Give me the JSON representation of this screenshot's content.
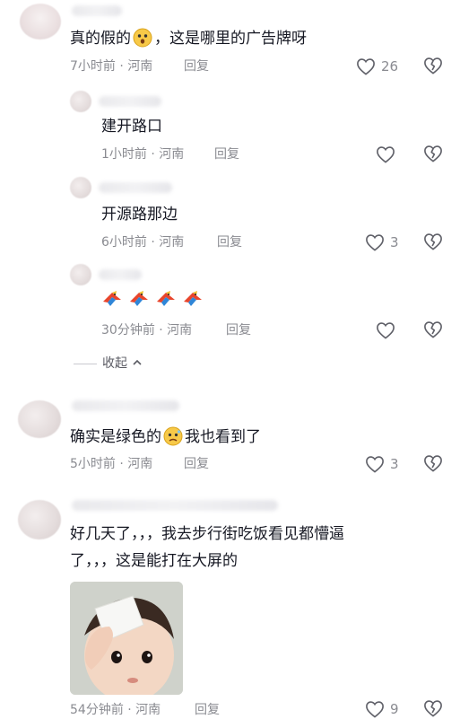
{
  "comments": [
    {
      "text": "真的假的",
      "text_after_emoji": "，这是哪里的广告牌呀",
      "meta": "7小时前 · 河南",
      "reply_label": "回复",
      "likes": "26",
      "replies": [
        {
          "text": "建开路口",
          "meta": "1小时前 · 河南",
          "reply_label": "回复",
          "likes": ""
        },
        {
          "text": "开源路那边",
          "meta": "6小时前 · 河南",
          "reply_label": "回复",
          "likes": "3"
        },
        {
          "text": "",
          "meta": "30分钟前 · 河南",
          "reply_label": "回复",
          "likes": ""
        }
      ],
      "collapse_label": "收起"
    },
    {
      "text": "确实是绿色的",
      "text_after_emoji": "我也看到了",
      "meta": "5小时前 · 河南",
      "reply_label": "回复",
      "likes": "3"
    },
    {
      "text_line1": "好几天了，，，我去步行街吃饭看见都懵逼",
      "text_line2": "了，，，这是能打在大屏的",
      "meta": "54分钟前 · 河南",
      "reply_label": "回复",
      "likes": "9"
    }
  ],
  "colors": {
    "text": "#161823",
    "meta": "#8a8b91",
    "icon": "#5f6068"
  },
  "icons": {
    "like": "heart-outline-icon",
    "dislike": "broken-heart-icon",
    "chevron": "chevron-up-icon"
  }
}
